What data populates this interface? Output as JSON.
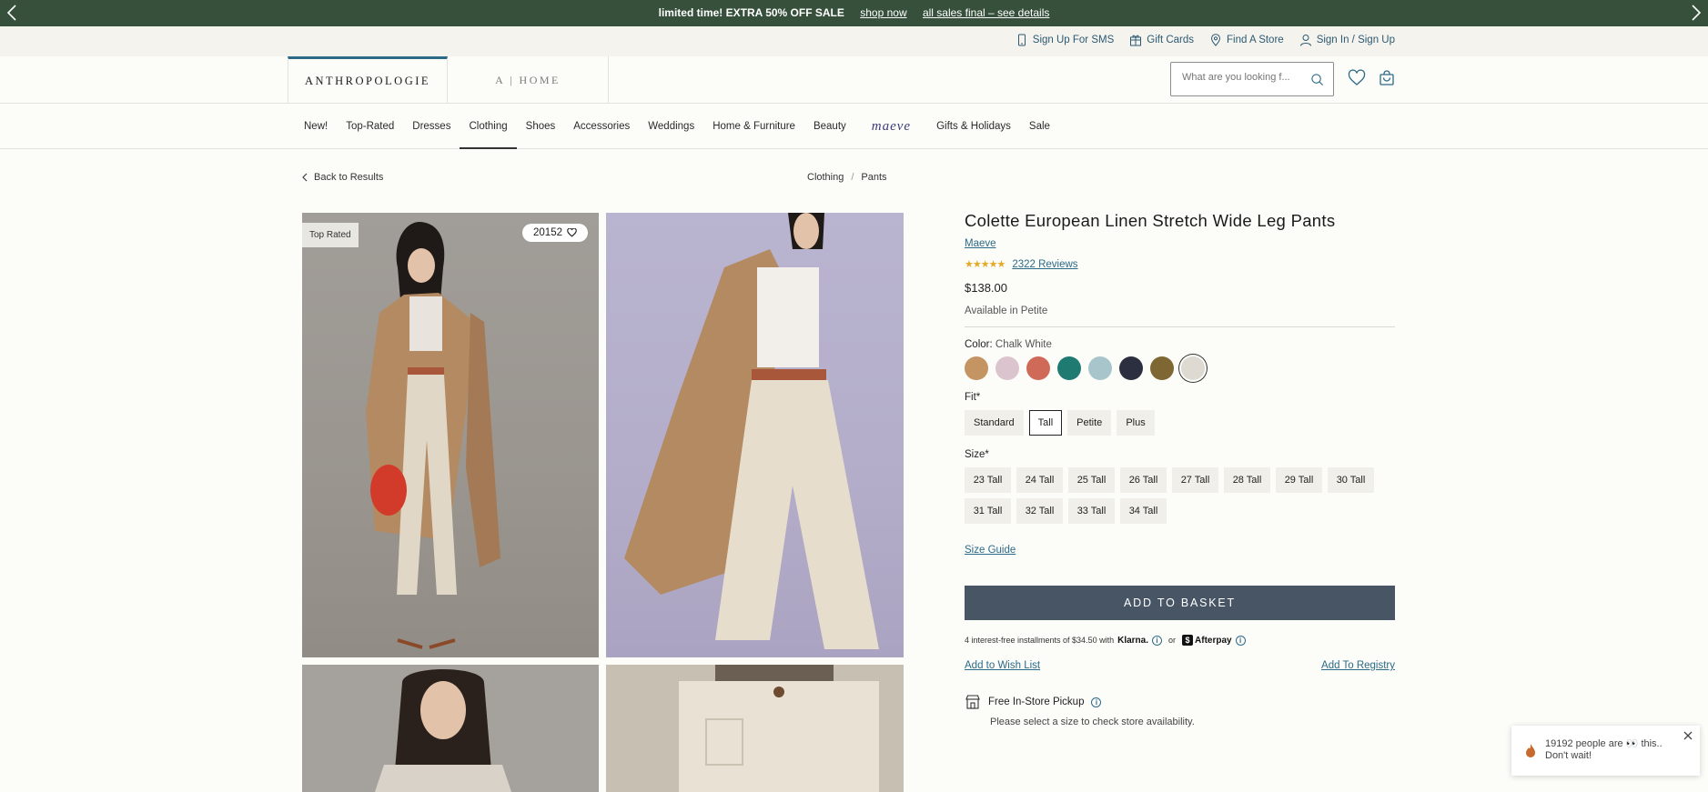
{
  "promo": {
    "message": "limited time! EXTRA 50% OFF SALE",
    "link1": "shop now",
    "link2": "all sales final – see details"
  },
  "utility": {
    "sms": "Sign Up For SMS",
    "gift": "Gift Cards",
    "store": "Find A Store",
    "signin": "Sign In / Sign Up"
  },
  "header": {
    "brand_main": "ANTHROPOLOGIE",
    "brand_home": "A | HOME",
    "search_placeholder": "What are you looking f..."
  },
  "nav": {
    "items": [
      "New!",
      "Top-Rated",
      "Dresses",
      "Clothing",
      "Shoes",
      "Accessories",
      "Weddings",
      "Home & Furniture",
      "Beauty",
      "maeve",
      "Gifts & Holidays",
      "Sale"
    ],
    "active": "Clothing"
  },
  "crumbs": {
    "back": "Back to Results",
    "c1": "Clothing",
    "sep": "/",
    "c2": "Pants"
  },
  "gallery": {
    "badge": "Top Rated",
    "favorites": "20152"
  },
  "product": {
    "title": "Colette European Linen Stretch Wide Leg Pants",
    "brand": "Maeve",
    "stars": "★★★★★",
    "reviews": "2322 Reviews",
    "price": "$138.00",
    "availability": "Available in Petite",
    "color_label": "Color:",
    "color_value": "Chalk White",
    "swatches": [
      "#c49462",
      "#dcc4cf",
      "#cf6a58",
      "#1f7a72",
      "#a7c5cb",
      "#2c2f3f",
      "#7e6733",
      "#dedad2"
    ],
    "fit_label": "Fit*",
    "fits": [
      "Standard",
      "Tall",
      "Petite",
      "Plus"
    ],
    "fit_selected": "Tall",
    "size_label": "Size*",
    "sizes_row1": [
      "23 Tall",
      "24 Tall",
      "25 Tall",
      "26 Tall",
      "27 Tall",
      "28 Tall",
      "29 Tall",
      "30 Tall"
    ],
    "sizes_row2": [
      "31 Tall",
      "32 Tall",
      "33 Tall",
      "34 Tall"
    ],
    "size_guide": "Size Guide",
    "add_to_basket": "ADD TO BASKET",
    "installments": "4 interest-free installments of $34.50 with",
    "klarna": "Klarna.",
    "or": "or",
    "afterpay": "Afterpay",
    "wishlist": "Add to Wish List",
    "registry": "Add To Registry",
    "pickup": "Free In-Store Pickup",
    "pickup_sub": "Please select a size to check store availability."
  },
  "toast": {
    "line1": "19192 people are 👀 this..",
    "line2": "Don't wait!"
  }
}
